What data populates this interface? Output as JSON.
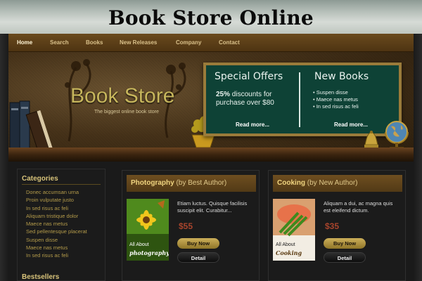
{
  "page_title": "Book Store Online",
  "nav": {
    "items": [
      "Home",
      "Search",
      "Books",
      "New Releases",
      "Company",
      "Contact"
    ],
    "active": "Home"
  },
  "banner": {
    "brand": "Book Store",
    "tagline": "The biggest online book store",
    "special_offers": {
      "title": "Special Offers",
      "highlight": "25%",
      "line1_rest": " discounts for",
      "line2": "purchase over $80",
      "read_more": "Read more..."
    },
    "new_books": {
      "title": "New Books",
      "items": [
        "Suspen disse",
        "Maece nas metus",
        "In sed risus ac feli"
      ],
      "read_more": "Read more..."
    }
  },
  "sidebar": {
    "categories_title": "Categories",
    "categories": [
      "Donec accumsan urna",
      "Proin vulputate justo",
      "In sed risus ac feli",
      "Aliquam tristique dolor",
      "Maece nas metus",
      "Sed pellentesque placerat",
      "Suspen disse",
      "Maece nas metus",
      "In sed risus ac feli"
    ],
    "bestsellers_title": "Bestsellers"
  },
  "products": [
    {
      "category": "Photography",
      "by": "(by Best Author)",
      "description": "Etiam luctus. Quisque facilisis suscipit elit. Curabitur...",
      "price": "$55",
      "buy_label": "Buy Now",
      "detail_label": "Detail",
      "cover_top": "All About",
      "cover_bottom": "photography"
    },
    {
      "category": "Cooking",
      "by": "(by New Author)",
      "description": "Aliquam a dui, ac magna quis est eleifend dictum.",
      "price": "$35",
      "buy_label": "Buy Now",
      "detail_label": "Detail",
      "cover_top": "All About",
      "cover_bottom": "Cooking"
    }
  ],
  "colors": {
    "nav_bg": "#5c3f17",
    "board_bg": "#0e4236",
    "brand_text": "#c7b65c",
    "price": "#a8442c",
    "category_link": "#b49b4a"
  }
}
